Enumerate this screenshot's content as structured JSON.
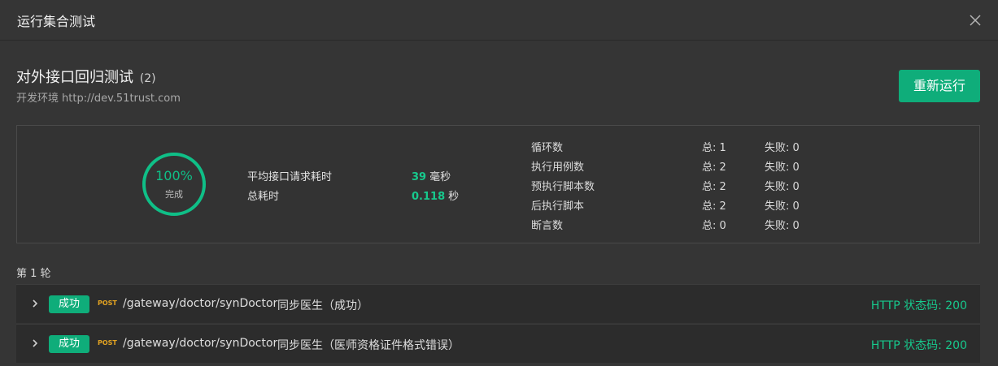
{
  "dialog": {
    "title": "运行集合测试"
  },
  "suite": {
    "name": "对外接口回归测试",
    "count": "(2)",
    "env_name": "开发环境",
    "env_url": "http://dev.51trust.com",
    "rerun_label": "重新运行"
  },
  "summary": {
    "progress_value": 100,
    "progress_text": "100%",
    "progress_label": "完成",
    "avg_label": "平均接口请求耗时",
    "avg_value": "39",
    "avg_unit": "毫秒",
    "total_label": "总耗时",
    "total_value": "0.118",
    "total_unit": "秒",
    "stats": [
      {
        "name": "循环数",
        "total": "总: 1",
        "fail": "失败: 0"
      },
      {
        "name": "执行用例数",
        "total": "总: 2",
        "fail": "失败: 0"
      },
      {
        "name": "预执行脚本数",
        "total": "总: 2",
        "fail": "失败: 0"
      },
      {
        "name": "后执行脚本",
        "total": "总: 2",
        "fail": "失败: 0"
      },
      {
        "name": "断言数",
        "total": "总: 0",
        "fail": "失败: 0"
      }
    ]
  },
  "round": {
    "label": "第 1 轮"
  },
  "results": [
    {
      "badge": "成功",
      "method": "POST",
      "path": "/gateway/doctor/synDoctor",
      "name": "同步医生（成功）",
      "status": "HTTP 状态码: 200"
    },
    {
      "badge": "成功",
      "method": "POST",
      "path": "/gateway/doctor/synDoctor",
      "name": "同步医生（医师资格证件格式错误）",
      "status": "HTTP 状态码: 200"
    }
  ],
  "colors": {
    "accent": "#0fad7a",
    "success_text": "#17c98d",
    "method_post": "#e3a321"
  },
  "icons": {
    "close": "close-icon",
    "expand": "chevron-right-icon"
  }
}
